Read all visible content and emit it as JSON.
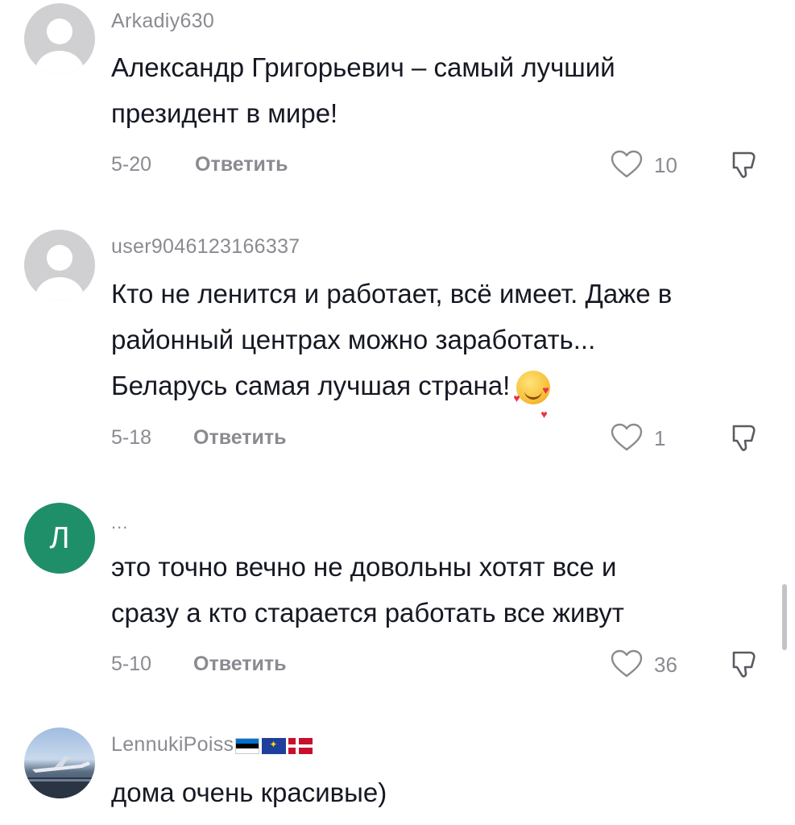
{
  "comments": [
    {
      "username": "Arkadiy630",
      "text_lines": [
        "Александр Григорьевич – самый лучший",
        "президент в мире!"
      ],
      "date": "5-20",
      "reply_label": "Ответить",
      "likes": "10",
      "avatar": "default-avatar"
    },
    {
      "username": "user9046123166337",
      "text_lines": [
        "Кто не ленится и работает, всё имеет. Даже в",
        "районный центрах можно заработать...",
        "Беларусь самая лучшая страна!"
      ],
      "emoji": "smiling-face-with-hearts",
      "date": "5-18",
      "reply_label": "Ответить",
      "likes": "1",
      "avatar": "default-avatar"
    },
    {
      "username": "...",
      "avatar_letter": "Л",
      "text_lines": [
        "это точно вечно не довольны хотят все и",
        "сразу а кто старается работать все живут"
      ],
      "date": "5-10",
      "reply_label": "Ответить",
      "likes": "36",
      "avatar": "letter-avatar"
    },
    {
      "username": "LennukiPoiss",
      "flags": [
        "estonia",
        "european-union",
        "denmark"
      ],
      "text_lines": [
        "дома очень красивые)"
      ],
      "avatar": "photo-avatar"
    }
  ],
  "colors": {
    "text_primary": "#161823",
    "text_secondary": "#8a8b91",
    "avatar_letter_bg": "#1f8f6a"
  },
  "icons": {
    "like": "heart-outline-icon",
    "dislike": "thumbs-down-outline-icon"
  }
}
